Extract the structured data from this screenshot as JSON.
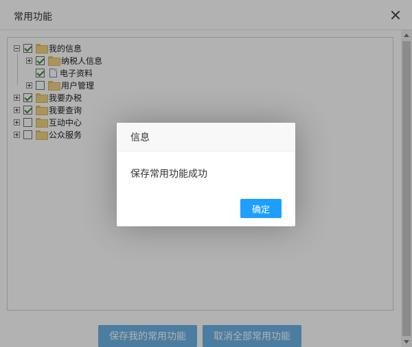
{
  "dialog": {
    "title": "常用功能"
  },
  "tree": {
    "items": [
      {
        "label": "我的信息",
        "expander": "minus",
        "checked": true,
        "icon": "folder-icon"
      },
      {
        "label": "纳税人信息",
        "expander": "plus",
        "checked": true,
        "icon": "folder-icon"
      },
      {
        "label": "电子资料",
        "expander": "none",
        "checked": true,
        "icon": "document-icon"
      },
      {
        "label": "用户管理",
        "expander": "plus",
        "checked": false,
        "icon": "folder-icon"
      },
      {
        "label": "我要办税",
        "expander": "plus",
        "checked": true,
        "icon": "folder-icon"
      },
      {
        "label": "我要查询",
        "expander": "plus",
        "checked": true,
        "icon": "folder-icon"
      },
      {
        "label": "互动中心",
        "expander": "plus",
        "checked": false,
        "icon": "folder-icon"
      },
      {
        "label": "公众服务",
        "expander": "plus",
        "checked": false,
        "icon": "folder-icon"
      }
    ]
  },
  "buttons": {
    "save": "保存我的常用功能",
    "cancel_all": "取消全部常用功能"
  },
  "modal": {
    "title": "信息",
    "message": "保存常用功能成功",
    "ok": "确定"
  },
  "colors": {
    "primary": "#1e9fff",
    "check": "#2e8b2e"
  }
}
